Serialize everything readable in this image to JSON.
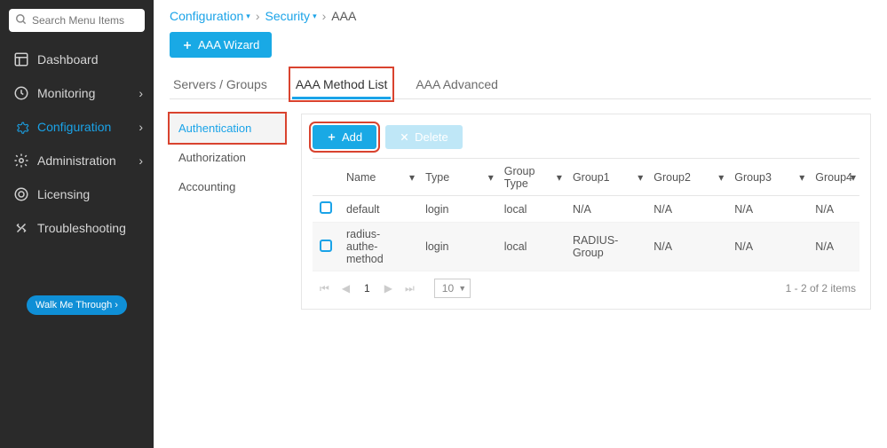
{
  "search": {
    "placeholder": "Search Menu Items"
  },
  "sidebar": {
    "items": [
      {
        "label": "Dashboard"
      },
      {
        "label": "Monitoring"
      },
      {
        "label": "Configuration"
      },
      {
        "label": "Administration"
      },
      {
        "label": "Licensing"
      },
      {
        "label": "Troubleshooting"
      }
    ],
    "walk_label": "Walk Me Through ›"
  },
  "breadcrumb": {
    "items": [
      "Configuration",
      "Security",
      "AAA"
    ]
  },
  "wizard_label": "AAA Wizard",
  "tabs": [
    "Servers / Groups",
    "AAA Method List",
    "AAA Advanced"
  ],
  "active_tab": 1,
  "subtabs": [
    "Authentication",
    "Authorization",
    "Accounting"
  ],
  "active_subtab": 0,
  "toolbar": {
    "add_label": "Add",
    "del_label": "Delete"
  },
  "table": {
    "columns": [
      "Name",
      "Type",
      "Group Type",
      "Group1",
      "Group2",
      "Group3",
      "Group4"
    ],
    "rows": [
      {
        "name": "default",
        "type": "login",
        "gtype": "local",
        "g1": "N/A",
        "g2": "N/A",
        "g3": "N/A",
        "g4": "N/A"
      },
      {
        "name": "radius-authe-method",
        "type": "login",
        "gtype": "local",
        "g1": "RADIUS-Group",
        "g2": "N/A",
        "g3": "N/A",
        "g4": "N/A"
      }
    ]
  },
  "pager": {
    "page": "1",
    "page_size": "10",
    "status": "1 - 2 of 2 items"
  }
}
